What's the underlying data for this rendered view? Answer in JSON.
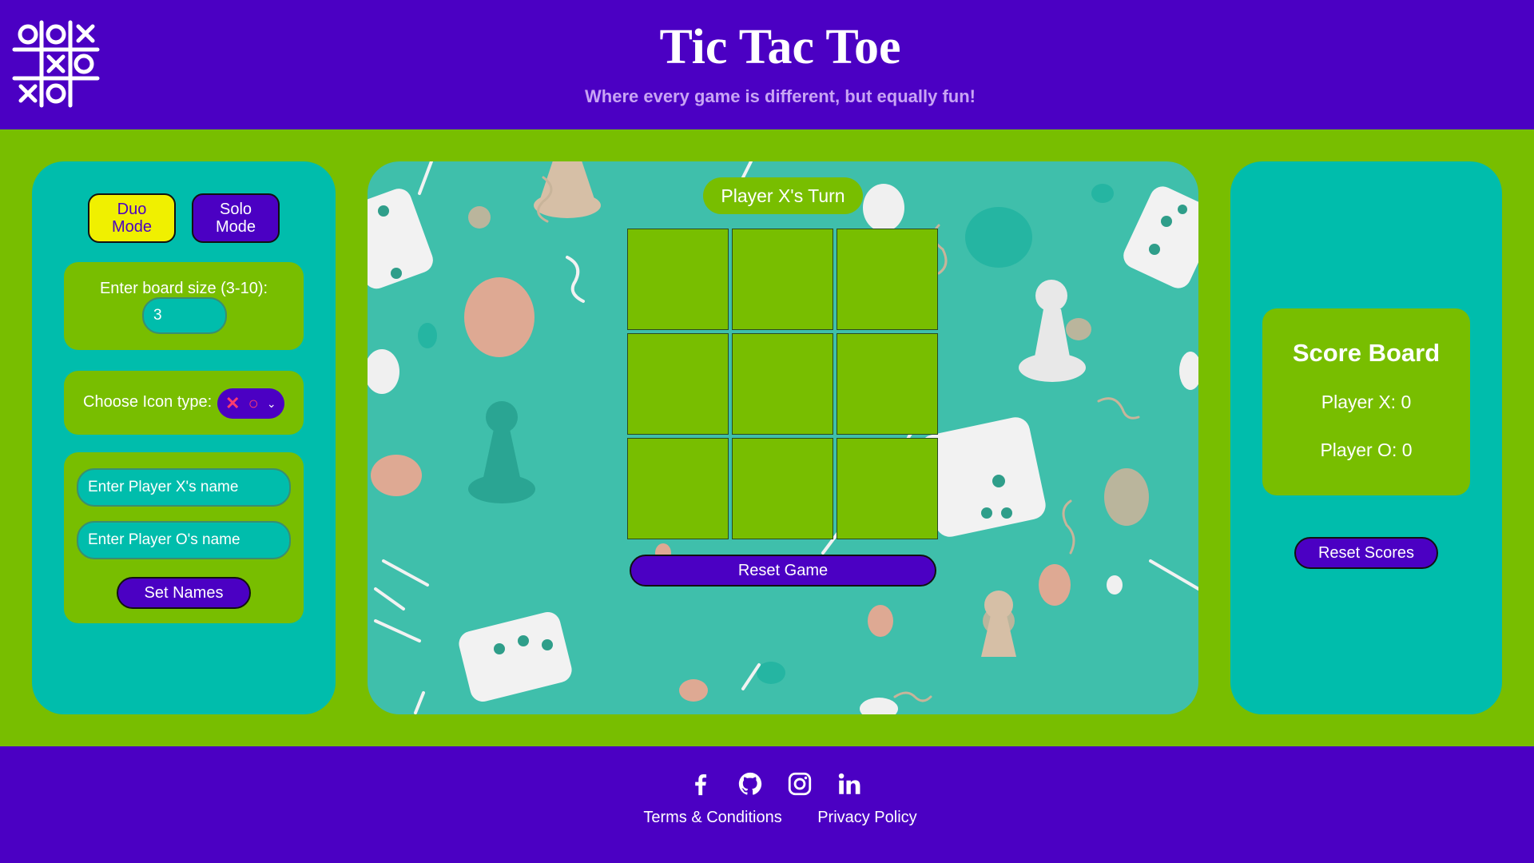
{
  "header": {
    "title": "Tic Tac Toe",
    "subtitle": "Where every game is different, but equally fun!",
    "logo_icon": "tic-tac-toe-logo"
  },
  "settings": {
    "duo_mode_label": "Duo\nMode",
    "solo_mode_label": "Solo\nMode",
    "active_mode": "duo",
    "board_size_label": "Enter board size (3-10):",
    "board_size_value": "3",
    "icon_type_label": "Choose Icon type:",
    "icon_type_value": "✕ ○",
    "player_x_placeholder": "Enter Player X's name",
    "player_o_placeholder": "Enter Player O's name",
    "set_names_label": "Set Names"
  },
  "game": {
    "turn_text": "Player X's Turn",
    "board": [
      "",
      "",
      "",
      "",
      "",
      "",
      "",
      "",
      ""
    ],
    "reset_game_label": "Reset Game"
  },
  "scoreboard": {
    "title": "Score Board",
    "player_x": "Player X: 0",
    "player_o": "Player O: 0",
    "reset_scores_label": "Reset Scores"
  },
  "footer": {
    "social_icons": [
      "facebook-icon",
      "github-icon",
      "instagram-icon",
      "linkedin-icon"
    ],
    "terms_label": "Terms & Conditions",
    "privacy_label": "Privacy Policy"
  },
  "colors": {
    "header_footer": "#4b00c3",
    "page_green": "#78be00",
    "panel_teal": "#00bdac",
    "duo_yellow": "#f0f000",
    "icon_pink": "#ff3c6e"
  }
}
